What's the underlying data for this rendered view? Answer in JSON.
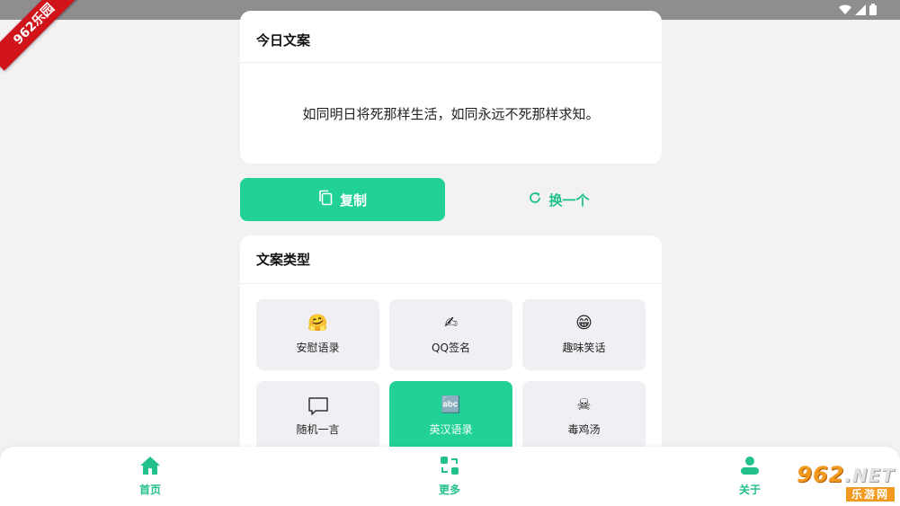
{
  "status_bar": {
    "icons": [
      "wifi-icon",
      "signal-icon",
      "battery-icon"
    ]
  },
  "ribbon": {
    "text": "962乐园"
  },
  "today": {
    "title": "今日文案",
    "quote": "如同明日将死那样生活，如同永远不死那样求知。"
  },
  "actions": {
    "copy_label": "复制",
    "change_label": "换一个"
  },
  "types": {
    "title": "文案类型",
    "items": [
      {
        "label": "安慰语录",
        "icon": "🤗",
        "active": false
      },
      {
        "label": "QQ签名",
        "icon": "✍",
        "active": false
      },
      {
        "label": "趣味笑话",
        "icon": "😁",
        "active": false
      },
      {
        "label": "随机一言",
        "icon": "speech-bubble-icon",
        "active": false
      },
      {
        "label": "英汉语录",
        "icon": "🔤",
        "active": true
      },
      {
        "label": "毒鸡汤",
        "icon": "☠",
        "active": false
      }
    ]
  },
  "nav": {
    "home": "首页",
    "more": "更多",
    "about": "关于"
  },
  "watermark": {
    "top": "962",
    "top_suffix": ".NET",
    "bottom": "乐游网"
  },
  "colors": {
    "accent": "#22d197",
    "accent_text": "#22c08c",
    "background": "#f2f2f5"
  }
}
